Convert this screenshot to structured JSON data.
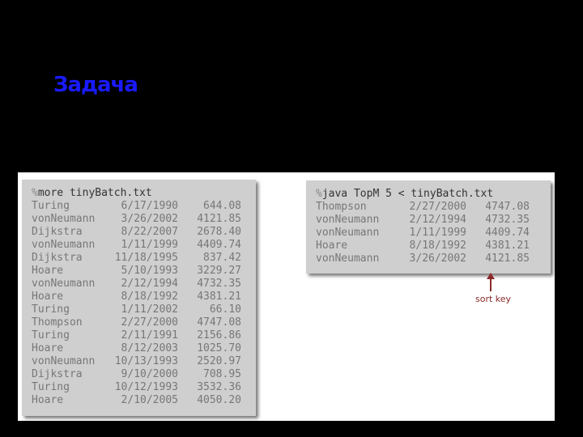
{
  "title": "Задача",
  "left_terminal": {
    "prompt": "%",
    "command": "more tinyBatch.txt",
    "rows": [
      {
        "name": "Turing",
        "date": "6/17/1990",
        "amount": "644.08"
      },
      {
        "name": "vonNeumann",
        "date": "3/26/2002",
        "amount": "4121.85"
      },
      {
        "name": "Dijkstra",
        "date": "8/22/2007",
        "amount": "2678.40"
      },
      {
        "name": "vonNeumann",
        "date": "1/11/1999",
        "amount": "4409.74"
      },
      {
        "name": "Dijkstra",
        "date": "11/18/1995",
        "amount": "837.42"
      },
      {
        "name": "Hoare",
        "date": "5/10/1993",
        "amount": "3229.27"
      },
      {
        "name": "vonNeumann",
        "date": "2/12/1994",
        "amount": "4732.35"
      },
      {
        "name": "Hoare",
        "date": "8/18/1992",
        "amount": "4381.21"
      },
      {
        "name": "Turing",
        "date": "1/11/2002",
        "amount": "66.10"
      },
      {
        "name": "Thompson",
        "date": "2/27/2000",
        "amount": "4747.08"
      },
      {
        "name": "Turing",
        "date": "2/11/1991",
        "amount": "2156.86"
      },
      {
        "name": "Hoare",
        "date": "8/12/2003",
        "amount": "1025.70"
      },
      {
        "name": "vonNeumann",
        "date": "10/13/1993",
        "amount": "2520.97"
      },
      {
        "name": "Dijkstra",
        "date": "9/10/2000",
        "amount": "708.95"
      },
      {
        "name": "Turing",
        "date": "10/12/1993",
        "amount": "3532.36"
      },
      {
        "name": "Hoare",
        "date": "2/10/2005",
        "amount": "4050.20"
      }
    ]
  },
  "right_terminal": {
    "prompt": "%",
    "command": "java TopM 5 < tinyBatch.txt",
    "rows": [
      {
        "name": "Thompson",
        "date": "2/27/2000",
        "amount": "4747.08"
      },
      {
        "name": "vonNeumann",
        "date": "2/12/1994",
        "amount": "4732.35"
      },
      {
        "name": "vonNeumann",
        "date": "1/11/1999",
        "amount": "4409.74"
      },
      {
        "name": "Hoare",
        "date": "8/18/1992",
        "amount": "4381.21"
      },
      {
        "name": "vonNeumann",
        "date": "3/26/2002",
        "amount": "4121.85"
      }
    ]
  },
  "annotation": {
    "label": "sort key",
    "color": "#8b2a2a"
  },
  "colors": {
    "title": "#1a1aff",
    "background": "#000000"
  }
}
